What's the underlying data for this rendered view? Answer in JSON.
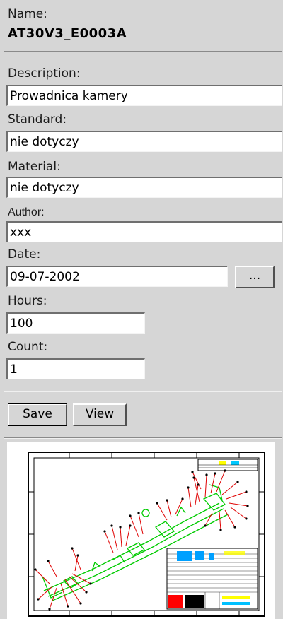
{
  "form": {
    "name_label": "Name:",
    "name_value": "AT30V3_E0003A",
    "description_label": "Description:",
    "description_value": "Prowadnica kamery",
    "standard_label": "Standard:",
    "standard_value": "nie dotyczy",
    "material_label": "Material:",
    "material_value": "nie dotyczy",
    "author_label": "Author:",
    "author_value": "xxx",
    "date_label": "Date:",
    "date_value": "09-07-2002",
    "date_picker_label": "...",
    "hours_label": "Hours:",
    "hours_value": "100",
    "count_label": "Count:",
    "count_value": "1"
  },
  "actions": {
    "save_label": "Save",
    "view_label": "View"
  },
  "colors": {
    "panel_bg": "#d6d6d6",
    "drawing_green": "#00cc00",
    "drawing_red": "#e00000"
  }
}
